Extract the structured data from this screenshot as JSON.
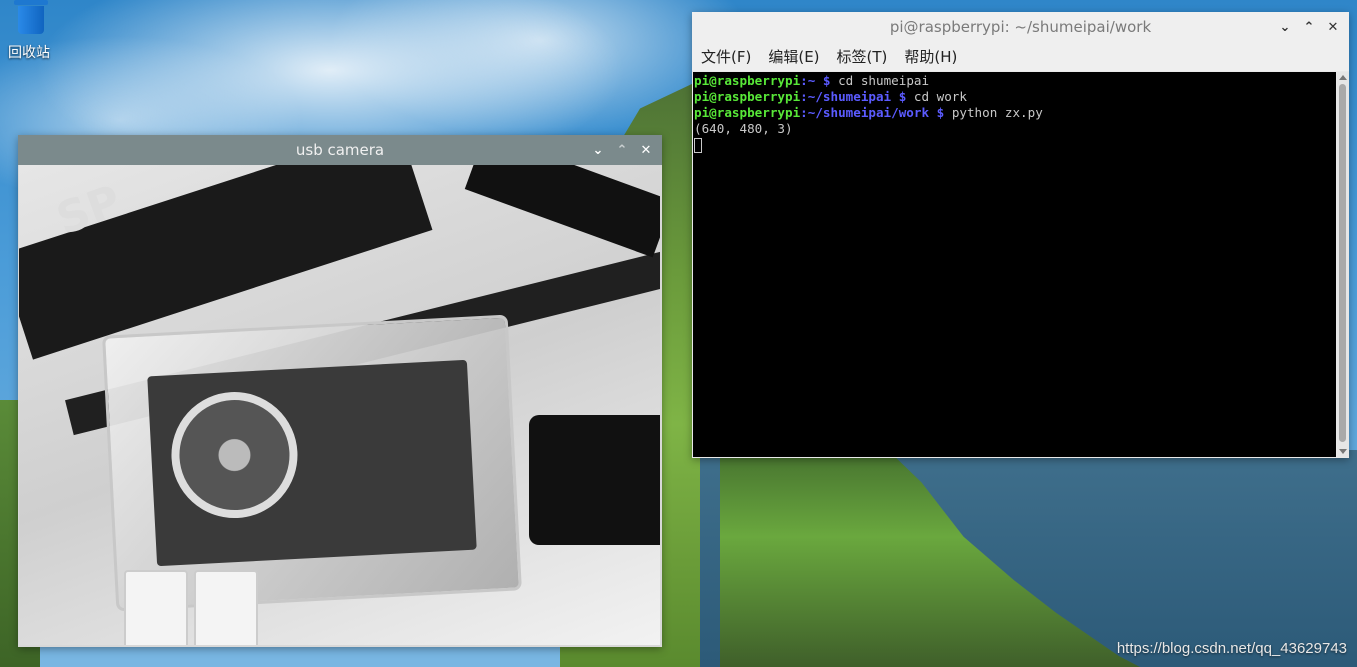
{
  "desktop": {
    "trash_label": "回收站",
    "watermark": "https://blog.csdn.net/qq_43629743"
  },
  "camera_window": {
    "title": "usb camera",
    "controls": {
      "minimize": "⌄",
      "maximize": "⌃",
      "close": "✕"
    },
    "feed_text": {
      "logo": "SP"
    }
  },
  "terminal_window": {
    "title": "pi@raspberrypi: ~/shumeipai/work",
    "controls": {
      "minimize": "⌄",
      "maximize": "⌃",
      "close": "✕"
    },
    "menu": [
      "文件(F)",
      "编辑(E)",
      "标签(T)",
      "帮助(H)"
    ],
    "lines": [
      {
        "user": "pi@raspberrypi",
        "path": ":~ $ ",
        "cmd": "cd shumeipai"
      },
      {
        "user": "pi@raspberrypi",
        "path": ":~/shumeipai $ ",
        "cmd": "cd work"
      },
      {
        "user": "pi@raspberrypi",
        "path": ":~/shumeipai/work $ ",
        "cmd": "python zx.py"
      }
    ],
    "output": "(640, 480, 3)"
  },
  "colors": {
    "prompt_user": "#58e838",
    "prompt_path": "#5b5bff",
    "terminal_bg": "#000000",
    "camera_titlebar": "#7b8a8c"
  }
}
